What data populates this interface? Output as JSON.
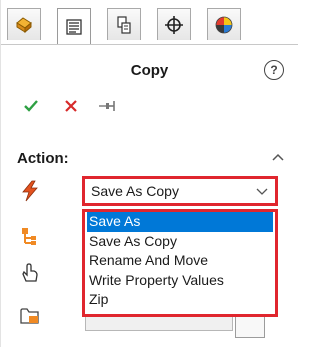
{
  "panel": {
    "title": "Copy",
    "help_label": "?",
    "section_label": "Action:"
  },
  "tabs": [
    {
      "icon": "feature-manager-icon",
      "active": false
    },
    {
      "icon": "property-manager-icon",
      "active": true
    },
    {
      "icon": "configuration-manager-icon",
      "active": false
    },
    {
      "icon": "dimxpert-manager-icon",
      "active": false
    },
    {
      "icon": "display-manager-icon",
      "active": false
    }
  ],
  "actions": [
    {
      "icon": "ok-checkmark-icon",
      "color": "#2ea043"
    },
    {
      "icon": "cancel-x-icon",
      "color": "#d72a2a"
    },
    {
      "icon": "pushpin-icon",
      "color": "#777777"
    }
  ],
  "combo": {
    "value": "Save As Copy",
    "options": [
      "Save As",
      "Save As Copy",
      "Rename And Move",
      "Write Property Values",
      "Zip"
    ],
    "highlighted": "Save As"
  },
  "colors": {
    "highlight_border": "#e0262e",
    "selection": "#0078d7"
  }
}
